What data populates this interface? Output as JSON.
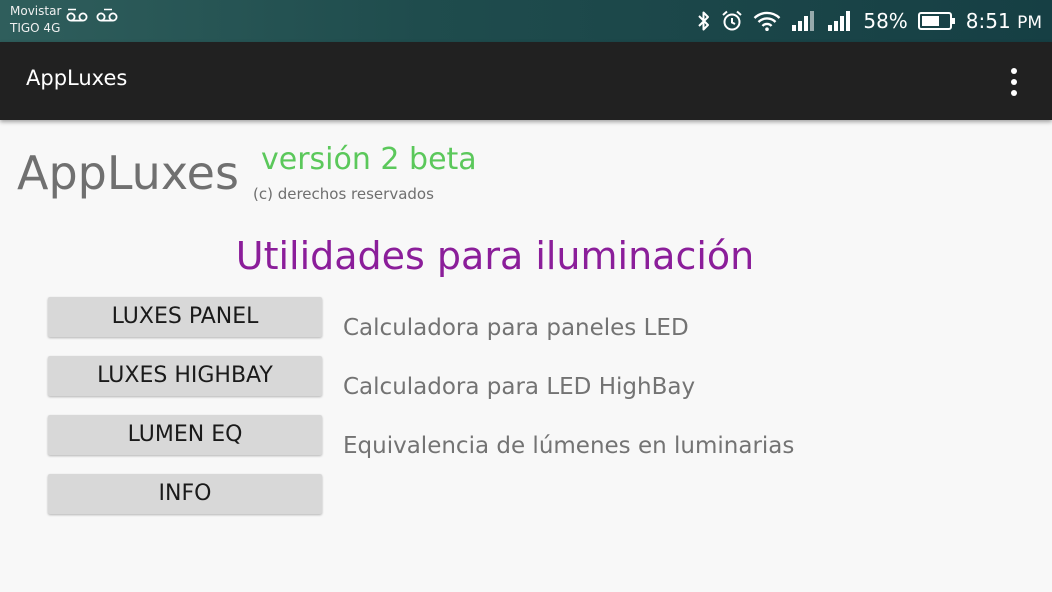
{
  "status_bar": {
    "carrier_line1": "Movistar",
    "carrier_line2": "TIGO 4G",
    "icons": [
      "voicemail-icon",
      "voicemail-icon",
      "bluetooth-icon",
      "alarm-icon",
      "wifi-icon",
      "signal-icon",
      "signal-icon",
      "battery-icon"
    ],
    "battery_percent": "58%",
    "time": "8:51",
    "ampm": "PM"
  },
  "app_bar": {
    "title": "AppLuxes",
    "menu_icon": "overflow-menu-icon"
  },
  "main": {
    "brand_title": "AppLuxes",
    "version": "versión 2 beta",
    "rights": "(c) derechos reservados",
    "heading": "Utilidades para iluminación",
    "buttons": [
      {
        "label": "LUXES PANEL",
        "description": "Calculadora para paneles LED"
      },
      {
        "label": "LUXES HIGHBAY",
        "description": "Calculadora para LED HighBay"
      },
      {
        "label": "LUMEN EQ",
        "description": "Equivalencia de lúmenes en luminarias"
      },
      {
        "label": "INFO",
        "description": ""
      }
    ]
  },
  "colors": {
    "app_bar": "#212121",
    "version_green": "#5bc85b",
    "heading_purple": "#8b1e9a",
    "button_gray": "#d8d8d8"
  }
}
